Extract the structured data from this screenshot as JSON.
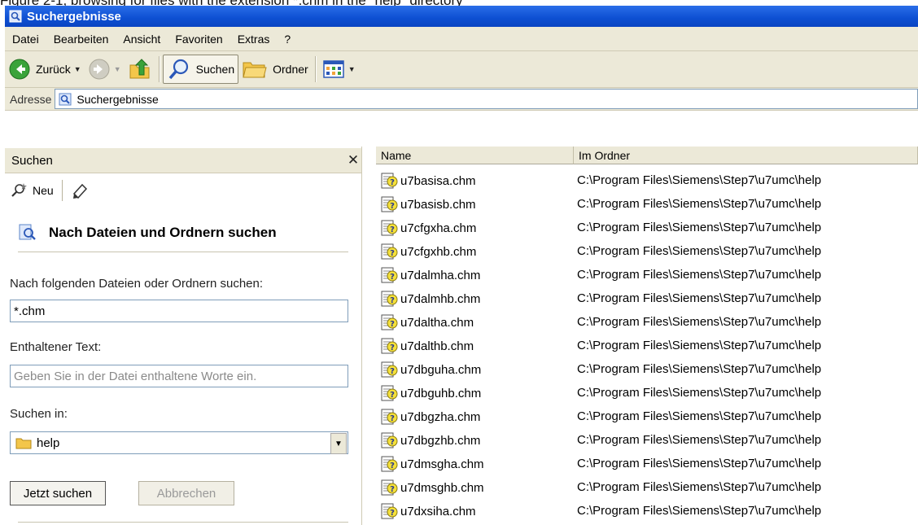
{
  "caption": "Figure 2-1, browsing for files with the extension *.chm in the \"help\" directory",
  "window": {
    "title": "Suchergebnisse"
  },
  "menu": [
    "Datei",
    "Bearbeiten",
    "Ansicht",
    "Favoriten",
    "Extras",
    "?"
  ],
  "toolbar": {
    "back_label": "Zurück",
    "search_label": "Suchen",
    "folders_label": "Ordner"
  },
  "address": {
    "label": "Adresse",
    "value": "Suchergebnisse"
  },
  "search_pane": {
    "title": "Suchen",
    "new_label": "Neu",
    "heading": "Nach Dateien und Ordnern suchen",
    "files_label": "Nach folgenden Dateien oder Ordnern suchen:",
    "files_value": "*.chm",
    "text_label": "Enthaltener Text:",
    "text_placeholder": "Geben Sie in der Datei enthaltene Worte ein.",
    "lookin_label": "Suchen in:",
    "lookin_value": "help",
    "search_button": "Jetzt suchen",
    "cancel_button": "Abbrechen"
  },
  "results": {
    "columns": {
      "name": "Name",
      "folder": "Im Ordner"
    },
    "rows": [
      {
        "name": "u7basisa.chm",
        "folder": "C:\\Program Files\\Siemens\\Step7\\u7umc\\help"
      },
      {
        "name": "u7basisb.chm",
        "folder": "C:\\Program Files\\Siemens\\Step7\\u7umc\\help"
      },
      {
        "name": "u7cfgxha.chm",
        "folder": "C:\\Program Files\\Siemens\\Step7\\u7umc\\help"
      },
      {
        "name": "u7cfgxhb.chm",
        "folder": "C:\\Program Files\\Siemens\\Step7\\u7umc\\help"
      },
      {
        "name": "u7dalmha.chm",
        "folder": "C:\\Program Files\\Siemens\\Step7\\u7umc\\help"
      },
      {
        "name": "u7dalmhb.chm",
        "folder": "C:\\Program Files\\Siemens\\Step7\\u7umc\\help"
      },
      {
        "name": "u7daltha.chm",
        "folder": "C:\\Program Files\\Siemens\\Step7\\u7umc\\help"
      },
      {
        "name": "u7dalthb.chm",
        "folder": "C:\\Program Files\\Siemens\\Step7\\u7umc\\help"
      },
      {
        "name": "u7dbguha.chm",
        "folder": "C:\\Program Files\\Siemens\\Step7\\u7umc\\help"
      },
      {
        "name": "u7dbguhb.chm",
        "folder": "C:\\Program Files\\Siemens\\Step7\\u7umc\\help"
      },
      {
        "name": "u7dbgzha.chm",
        "folder": "C:\\Program Files\\Siemens\\Step7\\u7umc\\help"
      },
      {
        "name": "u7dbgzhb.chm",
        "folder": "C:\\Program Files\\Siemens\\Step7\\u7umc\\help"
      },
      {
        "name": "u7dmsgha.chm",
        "folder": "C:\\Program Files\\Siemens\\Step7\\u7umc\\help"
      },
      {
        "name": "u7dmsghb.chm",
        "folder": "C:\\Program Files\\Siemens\\Step7\\u7umc\\help"
      },
      {
        "name": "u7dxsiha.chm",
        "folder": "C:\\Program Files\\Siemens\\Step7\\u7umc\\help"
      }
    ]
  },
  "icons": {
    "window": "search-results-icon",
    "back": "back-arrow-icon",
    "forward": "forward-arrow-icon",
    "up": "folder-up-icon",
    "search": "magnifier-icon",
    "folders": "folder-icon",
    "views": "views-icon",
    "file": "chm-help-file-icon"
  },
  "colors": {
    "titlebar": "#0d4fd2",
    "chrome": "#ece9d8",
    "back_green": "#3aa33a"
  }
}
